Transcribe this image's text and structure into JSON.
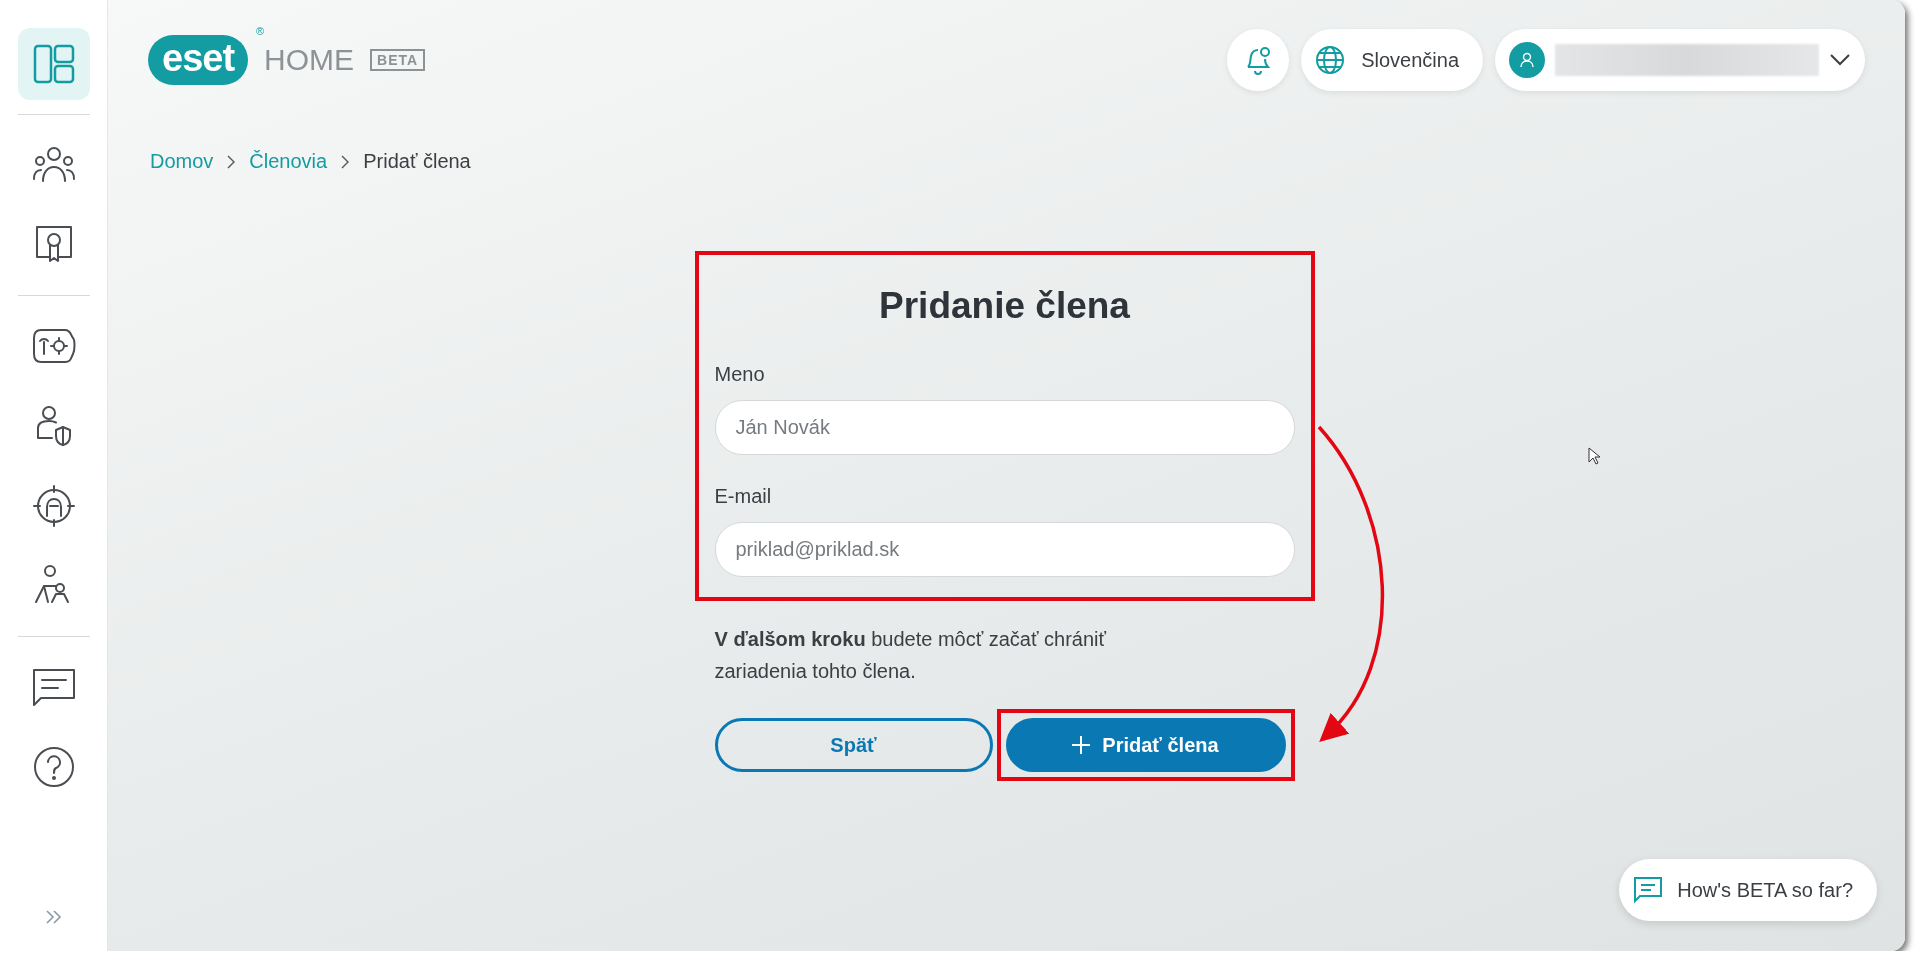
{
  "sidebar": {
    "groups": [
      {
        "items": [
          {
            "kind": "dashboard",
            "selected": true
          }
        ]
      },
      {
        "items": [
          {
            "kind": "members",
            "selected": false
          },
          {
            "kind": "license",
            "selected": false
          }
        ]
      },
      {
        "items": [
          {
            "kind": "router",
            "selected": false
          },
          {
            "kind": "identity",
            "selected": false
          },
          {
            "kind": "theft",
            "selected": false
          },
          {
            "kind": "parental",
            "selected": false
          }
        ]
      },
      {
        "items": [
          {
            "kind": "messages",
            "selected": false
          },
          {
            "kind": "help",
            "selected": false
          }
        ]
      }
    ]
  },
  "header": {
    "logo": {
      "brand": "eset",
      "registered": "®",
      "product": "HOME",
      "badge": "BETA"
    },
    "language": "Slovenčina"
  },
  "breadcrumbs": [
    {
      "label": "Domov",
      "kind": "link"
    },
    {
      "label": "Členovia",
      "kind": "link"
    },
    {
      "label": "Pridať člena",
      "kind": "current"
    }
  ],
  "form": {
    "title": "Pridanie člena",
    "fields": [
      {
        "label": "Meno",
        "placeholder": "Ján Novák"
      },
      {
        "label": "E-mail",
        "placeholder": "priklad@priklad.sk"
      }
    ],
    "note": "**V ďalšom kroku** budete môcť začať chrániť zariadenia tohto člena.",
    "buttons": [
      {
        "label": "Späť",
        "kind": "secondary"
      },
      {
        "label": "Pridať člena",
        "kind": "primary"
      }
    ]
  },
  "feedback": "How's BETA so far?"
}
